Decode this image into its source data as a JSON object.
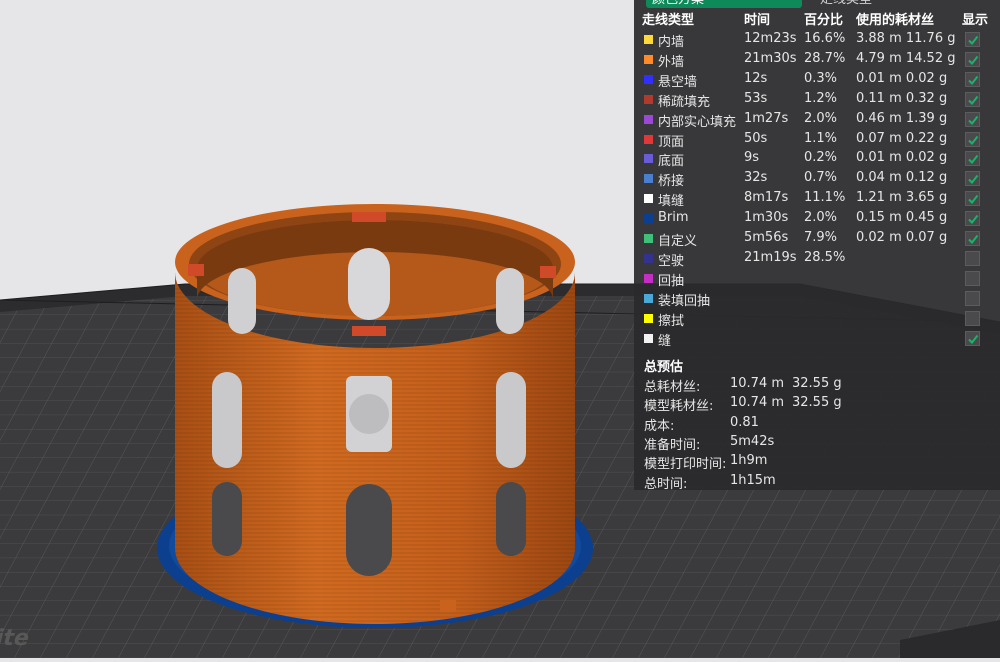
{
  "panel": {
    "tabs": [
      "颜色方案",
      "走线类型"
    ],
    "headers": {
      "type": "走线类型",
      "time": "时间",
      "percent": "百分比",
      "usage": "使用的耗材丝",
      "show": "显示"
    },
    "rows": [
      {
        "color": "#ffd83a",
        "name": "内墙",
        "time": "12m23s",
        "percent": "16.6%",
        "usage": "3.88 m  11.76 g",
        "shown": true
      },
      {
        "color": "#ff8a2a",
        "name": "外墙",
        "time": "21m30s",
        "percent": "28.7%",
        "usage": "4.79 m  14.52 g",
        "shown": true
      },
      {
        "color": "#2f2fff",
        "name": "悬空墙",
        "time": "12s",
        "percent": "0.3%",
        "usage": "0.01 m  0.02 g",
        "shown": true
      },
      {
        "color": "#b03a2e",
        "name": "稀疏填充",
        "time": "53s",
        "percent": "1.2%",
        "usage": "0.11 m  0.32 g",
        "shown": true
      },
      {
        "color": "#9b48d6",
        "name": "内部实心填充",
        "time": "1m27s",
        "percent": "2.0%",
        "usage": "0.46 m  1.39 g",
        "shown": true
      },
      {
        "color": "#e03838",
        "name": "顶面",
        "time": "50s",
        "percent": "1.1%",
        "usage": "0.07 m  0.22 g",
        "shown": true
      },
      {
        "color": "#6a5cd6",
        "name": "底面",
        "time": "9s",
        "percent": "0.2%",
        "usage": "0.01 m  0.02 g",
        "shown": true
      },
      {
        "color": "#4a7fd0",
        "name": "桥接",
        "time": "32s",
        "percent": "0.7%",
        "usage": "0.04 m  0.12 g",
        "shown": true
      },
      {
        "color": "#ffffff",
        "name": "填缝",
        "time": "8m17s",
        "percent": "11.1%",
        "usage": "1.21 m  3.65 g",
        "shown": true
      },
      {
        "color": "#0d3f8f",
        "name": "Brim",
        "time": "1m30s",
        "percent": "2.0%",
        "usage": "0.15 m  0.45 g",
        "shown": true
      },
      {
        "color": "#3fc07a",
        "name": "自定义",
        "time": "5m56s",
        "percent": "7.9%",
        "usage": "0.02 m  0.07 g",
        "shown": true
      },
      {
        "color": "#33338f",
        "name": "空驶",
        "time": "21m19s",
        "percent": "28.5%",
        "usage": "",
        "shown": false
      },
      {
        "color": "#c22fc2",
        "name": "回抽",
        "time": "",
        "percent": "",
        "usage": "",
        "shown": false
      },
      {
        "color": "#4aa8d8",
        "name": "装填回抽",
        "time": "",
        "percent": "",
        "usage": "",
        "shown": false
      },
      {
        "color": "#ffff00",
        "name": "擦拭",
        "time": "",
        "percent": "",
        "usage": "",
        "shown": false
      },
      {
        "color": "#f2f2f2",
        "name": "缝",
        "time": "",
        "percent": "",
        "usage": "",
        "shown": true
      }
    ],
    "summary": {
      "title": "总预估",
      "items": [
        {
          "label": "总耗材丝:",
          "value": "10.74 m",
          "value2": "32.55 g"
        },
        {
          "label": "模型耗材丝:",
          "value": "10.74 m",
          "value2": "32.55 g"
        },
        {
          "label": "成本:",
          "value": "0.81",
          "value2": ""
        },
        {
          "label": "准备时间:",
          "value": "5m42s",
          "value2": ""
        },
        {
          "label": "模型打印时间:",
          "value": "1h9m",
          "value2": ""
        },
        {
          "label": "总时间:",
          "value": "1h15m",
          "value2": ""
        }
      ]
    }
  },
  "viewport": {
    "logo_text": "ite",
    "colors": {
      "model": "#c8621c",
      "brim": "#0d3f8f",
      "plate": "#3b3b3d",
      "background": "#e6e6e8"
    }
  }
}
